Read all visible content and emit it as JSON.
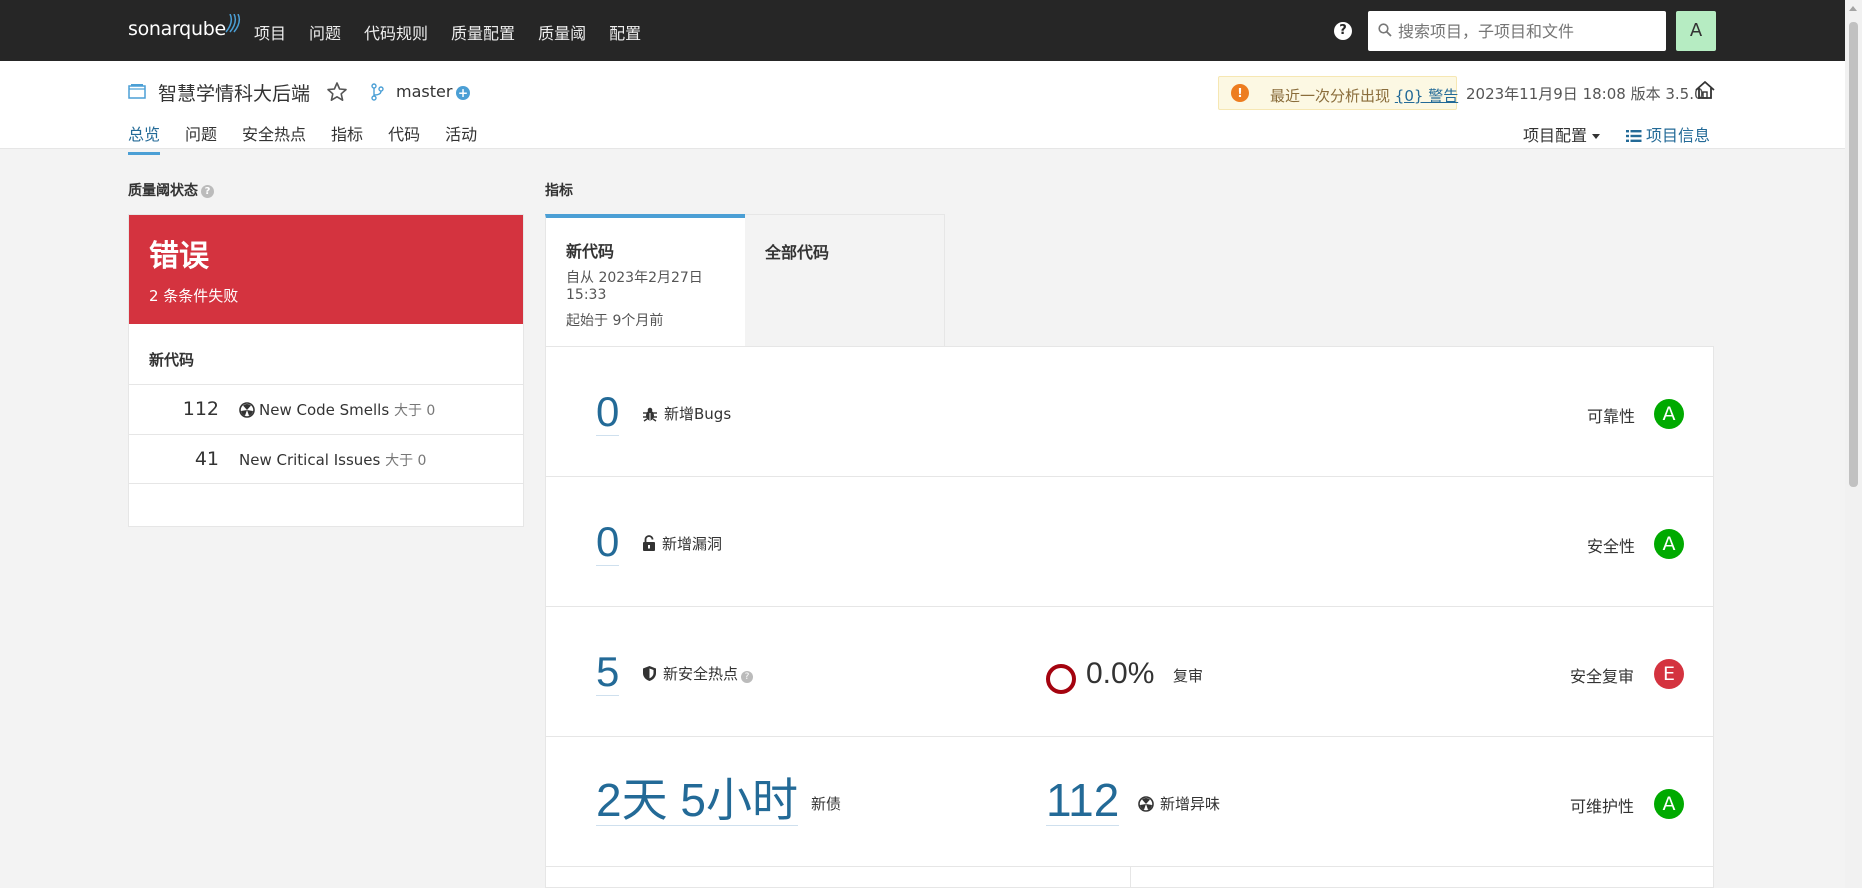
{
  "topnav": {
    "logo": "sonarqube",
    "items": [
      "项目",
      "问题",
      "代码规则",
      "质量配置",
      "质量阈",
      "配置"
    ],
    "search_placeholder": "搜索项目，子项目和文件",
    "avatar": "A",
    "help": "?"
  },
  "project": {
    "name": "智慧学情科大后端",
    "branch": "master",
    "warning_text": "最近一次分析出现",
    "warning_link": "{0} 警告",
    "analysis_date": "2023年11月9日 18:08  版本 3.5.0",
    "tabs": [
      "总览",
      "问题",
      "安全热点",
      "指标",
      "代码",
      "活动"
    ],
    "config_label": "项目配置",
    "info_label": "项目信息"
  },
  "quality_gate": {
    "title": "质量阈状态",
    "status": "错误",
    "failed_conditions": "2 条条件失败",
    "new_code_label": "新代码",
    "conditions": [
      {
        "value": "112",
        "metric": "New Code Smells",
        "op": "大于 0"
      },
      {
        "value": "41",
        "metric": "New Critical Issues",
        "op": "大于 0"
      }
    ]
  },
  "metrics": {
    "title": "指标",
    "tab_new": "新代码",
    "since": "自从 2023年2月27日 15:33",
    "started_ago": "起始于 9个月前",
    "tab_all": "全部代码",
    "bugs": {
      "value": "0",
      "label": "新增Bugs",
      "rating_label": "可靠性",
      "rating": "A"
    },
    "vulnerabilities": {
      "value": "0",
      "label": "新增漏洞",
      "rating_label": "安全性",
      "rating": "A"
    },
    "hotspots": {
      "value": "5",
      "label": "新安全热点",
      "reviewed_pct": "0.0%",
      "reviewed_label": "复审",
      "rating_label": "安全复审",
      "rating": "E"
    },
    "maintainability": {
      "debt": "2天 5小时",
      "debt_label": "新债",
      "smells": "112",
      "smells_label": "新增异味",
      "rating_label": "可维护性",
      "rating": "A"
    }
  },
  "colors": {
    "topbar": "#262626",
    "accent": "#236a97",
    "error": "#d4333f",
    "rating_a": "#00aa00",
    "rating_e": "#d4333f"
  }
}
